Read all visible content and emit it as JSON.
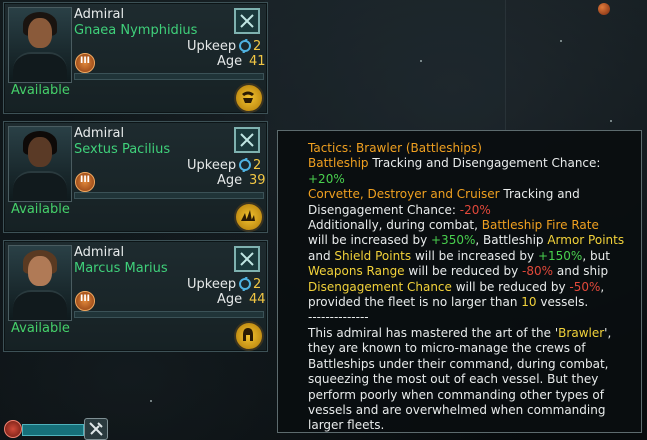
{
  "admirals": [
    {
      "rank": "Admiral",
      "name": "Gnaea Nymphidius",
      "upkeep_label": "Upkeep",
      "upkeep_value": "2",
      "age_label": "Age",
      "age_value": "41",
      "level": "III",
      "status": "Available",
      "trait_icon": "crab-trait-icon",
      "xp_progress": 0.0
    },
    {
      "rank": "Admiral",
      "name": "Sextus Pacilius",
      "upkeep_label": "Upkeep",
      "upkeep_value": "2",
      "age_label": "Age",
      "age_value": "39",
      "level": "III",
      "status": "Available",
      "trait_icon": "fleet-trait-icon",
      "xp_progress": 0.0
    },
    {
      "rank": "Admiral",
      "name": "Marcus Marius",
      "upkeep_label": "Upkeep",
      "upkeep_value": "2",
      "age_label": "Age",
      "age_value": "44",
      "level": "III",
      "status": "Available",
      "trait_icon": "helmet-trait-icon",
      "xp_progress": 0.0
    }
  ],
  "tooltip": {
    "title": "Tactics: Brawler (Battleships)",
    "l1_a": "Battleship",
    "l1_b": " Tracking and Disengagement Chance:",
    "l2": "+20%",
    "l3_a": "Corvette, Destroyer and Cruiser",
    "l3_b": " Tracking and",
    "l4_a": "Disengagement Chance: ",
    "l4_b": "-20%",
    "l5_a": "Additionally, during combat, ",
    "l5_b": "Battleship Fire Rate",
    "l6_a": "will be increased by ",
    "l6_b": "+350%",
    "l6_c": ", Battleship ",
    "l6_d": "Armor Points",
    "l7_a": "and ",
    "l7_b": "Shield Points",
    "l7_c": " will be increased by ",
    "l7_d": "+150%",
    "l7_e": ", but",
    "l8_a": "Weapons Range",
    "l8_b": " will be reduced by ",
    "l8_c": "-80%",
    "l8_d": " and ship",
    "l9_a": "Disengagement Chance",
    "l9_b": " will be reduced by ",
    "l9_c": "-50%",
    "l9_d": ",",
    "l10_a": "provided the fleet is no larger than ",
    "l10_b": "10",
    "l10_c": " vessels.",
    "divider": "--------------",
    "desc1_a": "This admiral has mastered the art of the '",
    "desc1_b": "Brawler",
    "desc1_c": "',",
    "desc2": "they are known to micro-manage the crews of",
    "desc3": "Battleships under their command, during combat,",
    "desc4": "squeezing the most out of each vessel. But they",
    "desc5": "perform poorly when commanding other types of",
    "desc6": "vessels and are overwhelmed when commanding",
    "desc7": "larger fleets."
  },
  "colors": {
    "name": "#3fd07a",
    "available": "#45d06a",
    "value": "#f2c744",
    "highlight_orange": "#f0a020",
    "positive": "#49d04e",
    "negative": "#e0483a",
    "keyword_yellow": "#f2d23a"
  }
}
